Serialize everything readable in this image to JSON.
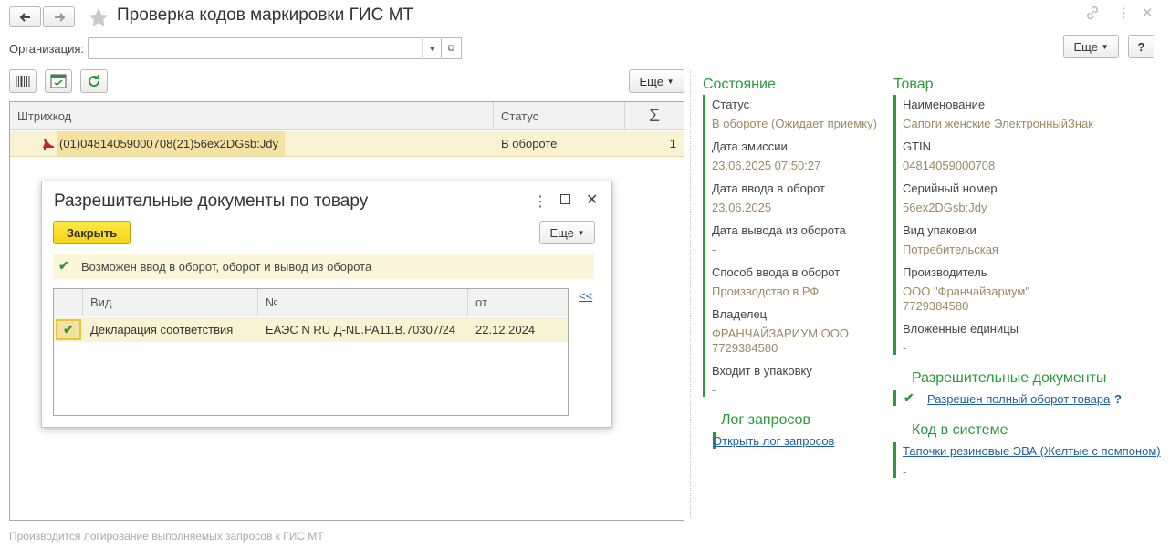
{
  "window": {
    "title": "Проверка кодов маркировки ГИС МТ",
    "organization_label": "Организация:",
    "organization_value": "",
    "more_label": "Еще",
    "help_label": "?"
  },
  "toolbar": {
    "more_label": "Еще"
  },
  "main_grid": {
    "columns": [
      "Штрихкод",
      "Статус",
      "Σ"
    ],
    "rows": [
      {
        "barcode": "(01)04814059000708(21)56ex2DGsb:Jdy",
        "status": "В обороте",
        "count": "1"
      }
    ]
  },
  "footer_note": "Производится логирование выполняемых запросов к ГИС МТ",
  "dialog": {
    "title": "Разрешительные документы по товару",
    "close_label": "Закрыть",
    "more_label": "Еще",
    "info_text": "Возможен ввод в оборот, оборот и вывод из оборота",
    "collapse_label": "<<",
    "columns": [
      "Вид",
      "№",
      "от"
    ],
    "rows": [
      {
        "kind": "Декларация соответствия",
        "number": "ЕАЭС N RU Д-NL.PA11.B.70307/24",
        "date": "22.12.2024"
      }
    ]
  },
  "state": {
    "title": "Состояние",
    "status_label": "Статус",
    "status_value": "В обороте (Ожидает приемку)",
    "emission_label": "Дата эмиссии",
    "emission_value": "23.06.2025 07:50:27",
    "input_label": "Дата ввода в оборот",
    "input_value": "23.06.2025",
    "output_label": "Дата вывода из оборота",
    "output_value": "-",
    "method_label": "Способ ввода в оборот",
    "method_value": "Производство в РФ",
    "owner_label": "Владелец",
    "owner_value_1": "ФРАНЧАЙЗАРИУМ ООО",
    "owner_value_2": "7729384580",
    "package_label": "Входит в упаковку",
    "package_value": "-"
  },
  "log": {
    "title": "Лог запросов",
    "link": "Открыть лог запросов"
  },
  "product": {
    "title": "Товар",
    "name_label": "Наименование",
    "name_value": "Сапоги женские ЭлектронныйЗнак",
    "gtin_label": "GTIN",
    "gtin_value": "04814059000708",
    "serial_label": "Серийный номер",
    "serial_value": "56ex2DGsb:Jdy",
    "pack_label": "Вид упаковки",
    "pack_value": "Потребительская",
    "maker_label": "Производитель",
    "maker_value_1": "ООО \"Франчайзариум\"",
    "maker_value_2": "7729384580",
    "nested_label": "Вложенные единицы",
    "nested_value": "-"
  },
  "permits": {
    "title": "Разрешительные документы",
    "link": "Разрешен полный оборот товара",
    "help": "?"
  },
  "system_code": {
    "title": "Код в системе",
    "link": "Тапочки резиновые ЭВА (Желтые с помпоном)",
    "value": "-"
  },
  "colors": {
    "accent_green": "#2a9a3a",
    "selected_row": "#faf3d3",
    "link_blue": "#1f5fa8",
    "muted_value": "#9a8b63"
  }
}
